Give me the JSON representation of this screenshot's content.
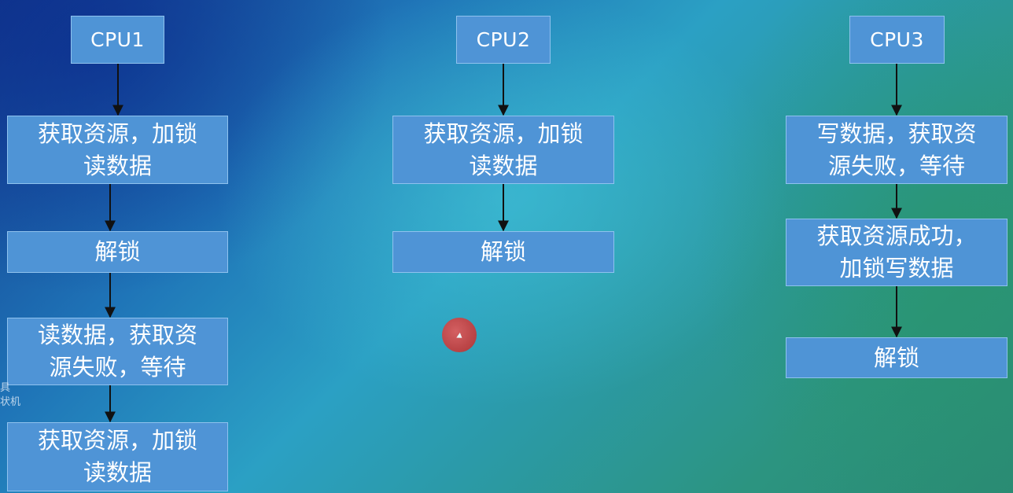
{
  "columns": [
    {
      "header": "CPU1",
      "steps": [
        "获取资源，加锁\n读数据",
        "解锁",
        "读数据，获取资\n源失败，等待",
        "获取资源，加锁\n读数据"
      ]
    },
    {
      "header": "CPU2",
      "steps": [
        "获取资源，加锁\n读数据",
        "解锁"
      ]
    },
    {
      "header": "CPU3",
      "steps": [
        "写数据，获取资\n源失败，等待",
        "获取资源成功，\n加锁写数据",
        "解锁"
      ]
    }
  ],
  "overlay": {
    "side_text": "具\n状机"
  },
  "colors": {
    "box_fill": "#4f94d6",
    "box_border": "#8fc2ee",
    "arrow": "#111111",
    "text": "#ffffff",
    "pointer": "#c43a3a"
  }
}
